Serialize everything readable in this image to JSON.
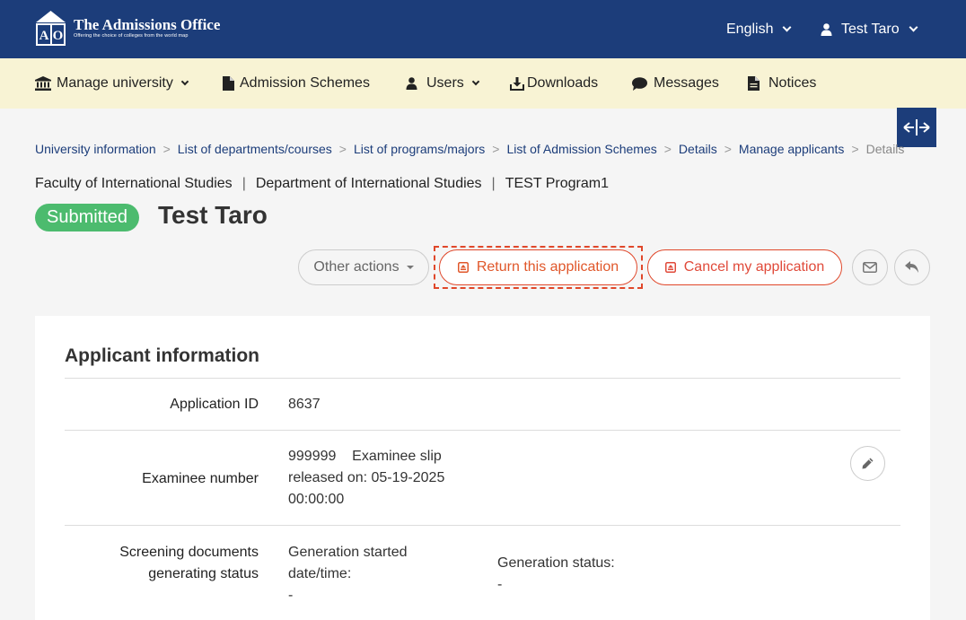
{
  "header": {
    "logo_title": "The Admissions Office",
    "logo_subtitle": "Offering the choice of colleges from the world map",
    "logo_letters": "AO",
    "language": "English",
    "user_name": "Test Taro"
  },
  "nav": {
    "items": [
      {
        "label": "Manage university",
        "icon": "university-icon",
        "dropdown": true
      },
      {
        "label": "Admission Schemes",
        "icon": "document-icon",
        "dropdown": false
      },
      {
        "label": "Users",
        "icon": "user-icon",
        "dropdown": true
      },
      {
        "label": "Downloads",
        "icon": "download-icon",
        "dropdown": false
      },
      {
        "label": "Messages",
        "icon": "chat-icon",
        "dropdown": false
      },
      {
        "label": "Notices",
        "icon": "document-icon",
        "dropdown": false
      }
    ]
  },
  "breadcrumb": [
    "University information",
    "List of departments/courses",
    "List of programs/majors",
    "List of Admission Schemes",
    "Details",
    "Manage applicants",
    "Details"
  ],
  "org": {
    "faculty": "Faculty of International Studies",
    "department": "Department of International Studies",
    "program": "TEST Program1"
  },
  "applicant": {
    "status": "Submitted",
    "name": "Test Taro"
  },
  "actions": {
    "other_actions": "Other actions",
    "return_label": "Return this application",
    "cancel_label": "Cancel my application"
  },
  "card": {
    "title": "Applicant information",
    "application_id_label": "Application ID",
    "application_id_value": "8637",
    "examinee_label": "Examinee number",
    "examinee_number": "999999",
    "examinee_slip": "Examinee slip",
    "examinee_released_line1": "released on: 05-19-2025",
    "examinee_released_line2": "00:00:00",
    "screening_label_line1": "Screening documents",
    "screening_label_line2": "generating status",
    "generation_started_line1": "Generation started",
    "generation_started_line2": "date/time:",
    "generation_started_value": "-",
    "generation_status_label": "Generation status:",
    "generation_status_value": "-"
  },
  "colors": {
    "header_bg": "#1c3d7a",
    "nav_bg": "#f8f3d4",
    "status_green": "#4cbb6e",
    "danger": "#e0472a"
  }
}
